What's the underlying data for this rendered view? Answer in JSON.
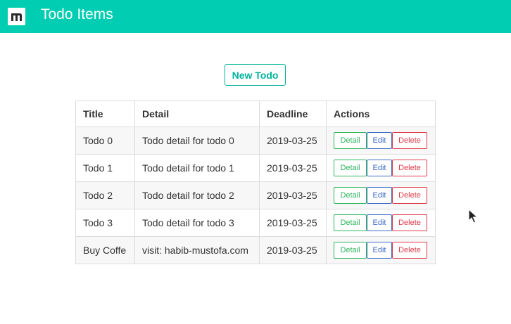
{
  "app": {
    "title": "Todo Items",
    "accent": "#00cdb1"
  },
  "toolbar": {
    "new_label": "New Todo"
  },
  "table": {
    "headers": {
      "title": "Title",
      "detail": "Detail",
      "deadline": "Deadline",
      "actions": "Actions"
    },
    "action_labels": {
      "detail": "Detail",
      "edit": "Edit",
      "delete": "Delete"
    },
    "rows": [
      {
        "title": "Todo 0",
        "detail": "Todo detail for todo 0",
        "deadline": "2019-03-25"
      },
      {
        "title": "Todo 1",
        "detail": "Todo detail for todo 1",
        "deadline": "2019-03-25"
      },
      {
        "title": "Todo 2",
        "detail": "Todo detail for todo 2",
        "deadline": "2019-03-25"
      },
      {
        "title": "Todo 3",
        "detail": "Todo detail for todo 3",
        "deadline": "2019-03-25"
      },
      {
        "title": "Buy Coffe",
        "detail": "visit: habib-mustofa.com",
        "deadline": "2019-03-25"
      }
    ]
  },
  "colors": {
    "detail": "#2db55d",
    "edit": "#3c6bc7",
    "delete": "#e03a4a"
  },
  "icons": {
    "logo": "m-logo-icon",
    "cursor": "mouse-cursor-icon"
  }
}
